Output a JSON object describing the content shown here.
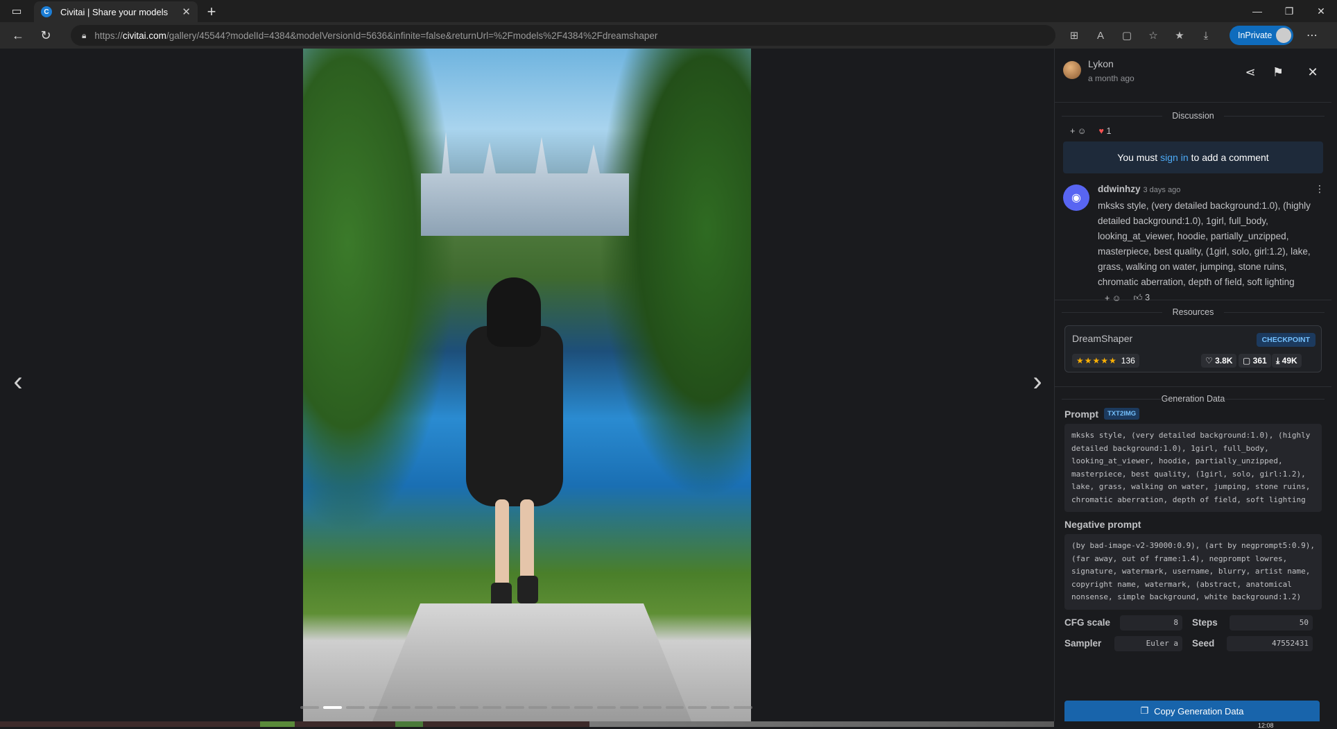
{
  "browser": {
    "tab_title": "Civitai | Share your models",
    "favicon_letter": "C",
    "url_prefix": "https://",
    "url_host": "civitai.com",
    "url_rest": "/gallery/45544?modelId=4384&modelVersionId=5636&infinite=false&returnUrl=%2Fmodels%2F4384%2Fdreamshaper",
    "inprivate_label": "InPrivate"
  },
  "gallery": {
    "dot_count": 20,
    "active_dot": 1
  },
  "panel": {
    "user": {
      "name": "Lykon",
      "time": "a month ago"
    },
    "discussion": {
      "title": "Discussion",
      "reaction_add": "+ ☺",
      "heart_count": "1",
      "signin_prefix": "You must",
      "signin_link": "sign in",
      "signin_suffix": "to add a comment",
      "comment": {
        "author": "ddwinhzy",
        "time": "3 days ago",
        "body": "mksks style, (very detailed background:1.0), (highly detailed background:1.0), 1girl, full_body, looking_at_viewer, hoodie, partially_unzipped, masterpiece, best quality, (1girl, solo, girl:1.2), lake, grass, walking on water, jumping, stone ruins, chromatic aberration, depth of field, soft lighting",
        "reaction_add": "+ ☺",
        "like_count": "3"
      }
    },
    "resources": {
      "title": "Resources",
      "name": "DreamShaper",
      "badge": "CHECKPOINT",
      "rating_count": "136",
      "likes": "3.8K",
      "comments": "361",
      "downloads": "49K",
      "rating": 5
    },
    "generation": {
      "title": "Generation Data",
      "prompt_label": "Prompt",
      "prompt_badge": "TXT2IMG",
      "prompt": "mksks style, (very detailed background:1.0), (highly detailed background:1.0), 1girl, full_body, looking_at_viewer, hoodie, partially_unzipped, masterpiece, best quality, (1girl, solo, girl:1.2), lake, grass, walking on water, jumping, stone ruins, chromatic aberration, depth of field, soft lighting",
      "negative_label": "Negative prompt",
      "negative": "(by bad-image-v2-39000:0.9), (art by negprompt5:0.9), (far away, out of frame:1.4), negprompt lowres, signature, watermark, username, blurry, artist name, copyright name, watermark, (abstract, anatomical nonsense, simple background, white background:1.2)",
      "cfg_label": "CFG scale",
      "cfg_value": "8",
      "steps_label": "Steps",
      "steps_value": "50",
      "sampler_label": "Sampler",
      "sampler_value": "Euler a",
      "seed_label": "Seed",
      "seed_value": "47552431",
      "copy_label": "Copy Generation Data"
    }
  },
  "taskbar": {
    "clock": "12:08"
  }
}
